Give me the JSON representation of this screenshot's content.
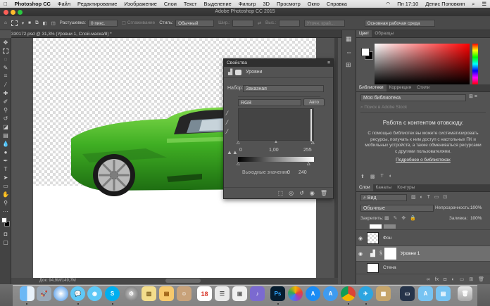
{
  "menubar": {
    "app": "Photoshop CC",
    "items": [
      "Файл",
      "Редактирование",
      "Изображение",
      "Слои",
      "Текст",
      "Выделение",
      "Фильтр",
      "3D",
      "Просмотр",
      "Окно",
      "Справка"
    ],
    "time": "Пн 17:10",
    "user": "Денис Поповкин"
  },
  "window": {
    "title": "Adobe Photoshop CC 2015"
  },
  "options": {
    "feather_label": "Растушевка:",
    "feather_value": "0 пикс.",
    "antialias_label": "Сглаживание",
    "style_label": "Стиль:",
    "style_value": "Обычный",
    "width_label": "Шир.:",
    "height_label": "Выс.:",
    "refine_label": "Уточн. край...",
    "workspace": "Основная рабочая среда"
  },
  "document": {
    "tab_title": "330172.psd @ 31,3% (Уровни 1, Слой-маска/8) *",
    "status": "Док: 94,9M/149,7M"
  },
  "properties": {
    "title": "Свойства",
    "adjustment_name": "Уровни",
    "preset_label": "Набор:",
    "preset_value": "Заказная",
    "channel": "RGB",
    "auto_label": "Авто",
    "input_black": "0",
    "input_gamma": "1,00",
    "input_white": "255",
    "output_label": "Выходные значения:",
    "output_black": "0",
    "output_white": "240"
  },
  "color_panel": {
    "tabs": [
      "Цвет",
      "Образцы"
    ],
    "fg_color": "#ffffff",
    "bg_color": "#000000",
    "hue_color": "#ff0000"
  },
  "libraries": {
    "tabs": [
      "Библиотеки",
      "Коррекция",
      "Стили"
    ],
    "library_name": "Моя библиотека",
    "search_placeholder": "Поиск в Adobe Stock",
    "heading": "Работа с контентом отовсюду.",
    "body": "С помощью библиотек вы можете систематизировать ресурсы, получать к ним доступ с настольных ПК и мобильных устройств, а также обмениваться ресурсами с другими пользователями.",
    "link": "Подробнее о библиотеках"
  },
  "layers": {
    "tabs": [
      "Слои",
      "Каналы",
      "Контуры"
    ],
    "filter_label": "Вид",
    "blend_mode": "Обычные",
    "opacity_label": "Непрозрачность:",
    "opacity_value": "100%",
    "lock_label": "Закрепить:",
    "fill_label": "Заливка:",
    "fill_value": "100%",
    "items": [
      {
        "name": "Фон"
      },
      {
        "name": "Уровни 1"
      },
      {
        "name": "Стена"
      }
    ]
  },
  "dock": {
    "calendar_day": "18",
    "icons": [
      "finder-icon",
      "launchpad-icon",
      "safari-icon",
      "messages-icon",
      "facetime-icon",
      "skype-icon",
      "system-preferences-icon",
      "notes-icon",
      "calendar-icon",
      "contacts-icon",
      "photoshop-icon",
      "photos-icon",
      "app-store-icon",
      "chrome-icon",
      "telegram-icon",
      "appstore-icon",
      "monitor-icon",
      "folder-icon",
      "downloads-icon",
      "trash-icon"
    ]
  }
}
